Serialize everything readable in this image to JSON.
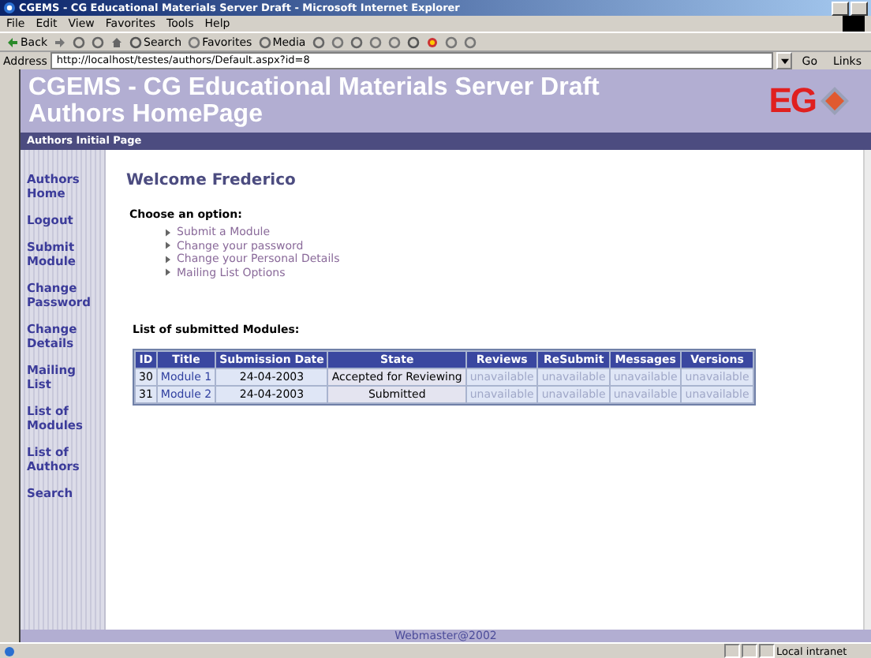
{
  "window": {
    "title": "CGEMS - CG Educational Materials Server Draft - Microsoft Internet Explorer"
  },
  "menu": [
    "File",
    "Edit",
    "View",
    "Favorites",
    "Tools",
    "Help"
  ],
  "toolbar": [
    {
      "kind": "back",
      "label": "Back"
    },
    {
      "kind": "forward"
    },
    {
      "kind": "stop"
    },
    {
      "kind": "refresh"
    },
    {
      "kind": "home"
    },
    {
      "kind": "search",
      "label": "Search"
    },
    {
      "kind": "favorites",
      "label": "Favorites"
    },
    {
      "kind": "media",
      "label": "Media"
    },
    {
      "kind": "history"
    },
    {
      "kind": "mail"
    },
    {
      "kind": "print"
    },
    {
      "kind": "edit"
    },
    {
      "kind": "discuss"
    },
    {
      "kind": "globe"
    },
    {
      "kind": "messenger"
    },
    {
      "kind": "tools"
    },
    {
      "kind": "person"
    }
  ],
  "address": {
    "label": "Address",
    "value": "http://localhost/testes/authors/Default.aspx?id=8",
    "go": "Go",
    "links": "Links"
  },
  "banner": {
    "title_lines": [
      "CGEMS - CG Educational Materials Server Draft",
      "Authors HomePage"
    ],
    "logo": "EG"
  },
  "subheader": "Authors Initial Page",
  "sidebar": {
    "items": [
      "Authors Home",
      "Logout",
      "Submit Module",
      "Change Password",
      "Change Details",
      "Mailing List",
      "List of Modules",
      "List of Authors",
      "Search"
    ]
  },
  "welcome": "Welcome Frederico",
  "choose": "Choose an option:",
  "options": [
    "Submit a Module",
    "Change your password",
    "Change your Personal Details",
    "Mailing List Options"
  ],
  "list_heading": "List of submitted Modules:",
  "table": {
    "columns": [
      "ID",
      "Title",
      "Submission Date",
      "State",
      "Reviews",
      "ReSubmit",
      "Messages",
      "Versions"
    ],
    "rows": [
      {
        "id": "30",
        "title": "Module 1",
        "date": "24-04-2003",
        "state": "Accepted for Reviewing",
        "reviews": "unavailable",
        "resubmit": "unavailable",
        "messages": "unavailable",
        "versions": "unavailable"
      },
      {
        "id": "31",
        "title": "Module 2",
        "date": "24-04-2003",
        "state": "Submitted",
        "reviews": "unavailable",
        "resubmit": "unavailable",
        "messages": "unavailable",
        "versions": "unavailable"
      }
    ]
  },
  "footer": "Webmaster@2002",
  "status_bar": {
    "zone": "Local intranet"
  }
}
